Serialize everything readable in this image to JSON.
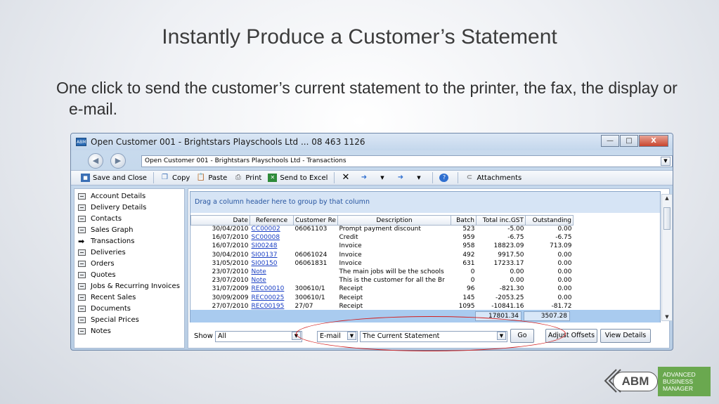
{
  "slide": {
    "title": "Instantly Produce a Customer’s Statement",
    "text": "One click to send the customer’s current statement to the printer, the fax, the display or e-mail."
  },
  "window": {
    "app_icon": "ABM",
    "title": "Open Customer 001 - Brightstars Playschools Ltd ... 08 463 1126",
    "controls": {
      "minimize": "—",
      "maximize": "□",
      "close": "X"
    }
  },
  "address": {
    "value": "Open Customer 001 - Brightstars Playschools Ltd - Transactions"
  },
  "toolbar": {
    "save_close": "Save and Close",
    "copy": "Copy",
    "paste": "Paste",
    "print": "Print",
    "send_excel": "Send to Excel",
    "attachments": "Attachments"
  },
  "sidebar": {
    "items": [
      {
        "label": "Account Details"
      },
      {
        "label": "Delivery Details"
      },
      {
        "label": "Contacts"
      },
      {
        "label": "Sales Graph"
      },
      {
        "label": "Transactions"
      },
      {
        "label": "Deliveries"
      },
      {
        "label": "Orders"
      },
      {
        "label": "Quotes"
      },
      {
        "label": "Jobs & Recurring Invoices"
      },
      {
        "label": "Recent Sales"
      },
      {
        "label": "Documents"
      },
      {
        "label": "Special Prices"
      },
      {
        "label": "Notes"
      }
    ],
    "active_index": 4
  },
  "grid": {
    "group_hint": "Drag a column header here to group by that column",
    "columns": [
      "Date",
      "Reference",
      "Customer Re",
      "Description",
      "Batch",
      "Total inc.GST",
      "Outstanding"
    ],
    "rows": [
      {
        "date": "30/04/2010",
        "ref": "CC00002",
        "custref": "06061103",
        "desc": "Prompt payment discount",
        "batch": "523",
        "total": "-5.00",
        "out": "0.00"
      },
      {
        "date": "16/07/2010",
        "ref": "SC00008",
        "custref": "",
        "desc": "Credit",
        "batch": "959",
        "total": "-6.75",
        "out": "-6.75"
      },
      {
        "date": "16/07/2010",
        "ref": "SI00248",
        "custref": "",
        "desc": "Invoice",
        "batch": "958",
        "total": "18823.09",
        "out": "713.09"
      },
      {
        "date": "30/04/2010",
        "ref": "SI00137",
        "custref": "06061024",
        "desc": "Invoice",
        "batch": "492",
        "total": "9917.50",
        "out": "0.00"
      },
      {
        "date": "31/05/2010",
        "ref": "SI00150",
        "custref": "06061831",
        "desc": "Invoice",
        "batch": "631",
        "total": "17233.17",
        "out": "0.00"
      },
      {
        "date": "23/07/2010",
        "ref": "Note",
        "custref": "",
        "desc": "The main jobs will be the schools",
        "batch": "0",
        "total": "0.00",
        "out": "0.00"
      },
      {
        "date": "23/07/2010",
        "ref": "Note",
        "custref": "",
        "desc": "This is the customer for all the Br",
        "batch": "0",
        "total": "0.00",
        "out": "0.00"
      },
      {
        "date": "31/07/2009",
        "ref": "REC00010",
        "custref": "300610/1",
        "desc": "Receipt",
        "batch": "96",
        "total": "-821.30",
        "out": "0.00"
      },
      {
        "date": "30/09/2009",
        "ref": "REC00025",
        "custref": "300610/1",
        "desc": "Receipt",
        "batch": "145",
        "total": "-2053.25",
        "out": "0.00"
      },
      {
        "date": "27/07/2010",
        "ref": "REC00195",
        "custref": "27/07",
        "desc": "Receipt",
        "batch": "1095",
        "total": "-10841.16",
        "out": "-81.72"
      }
    ],
    "totals": {
      "total": "17801.34",
      "outstanding": "3507.28"
    }
  },
  "bottom": {
    "show_label": "Show",
    "show_value": "All",
    "send_value": "E-mail",
    "statement_value": "The Current Statement",
    "go": "Go",
    "adjust": "Adjust Offsets",
    "view": "View Details"
  },
  "logo": {
    "abm": "ABM",
    "line1": "ADVANCED",
    "line2": "BUSINESS",
    "line3": "MANAGER"
  },
  "colors": {
    "accent_green": "#6aa84f",
    "link_blue": "#1a3fc4",
    "highlight_red": "#d21e1e"
  }
}
